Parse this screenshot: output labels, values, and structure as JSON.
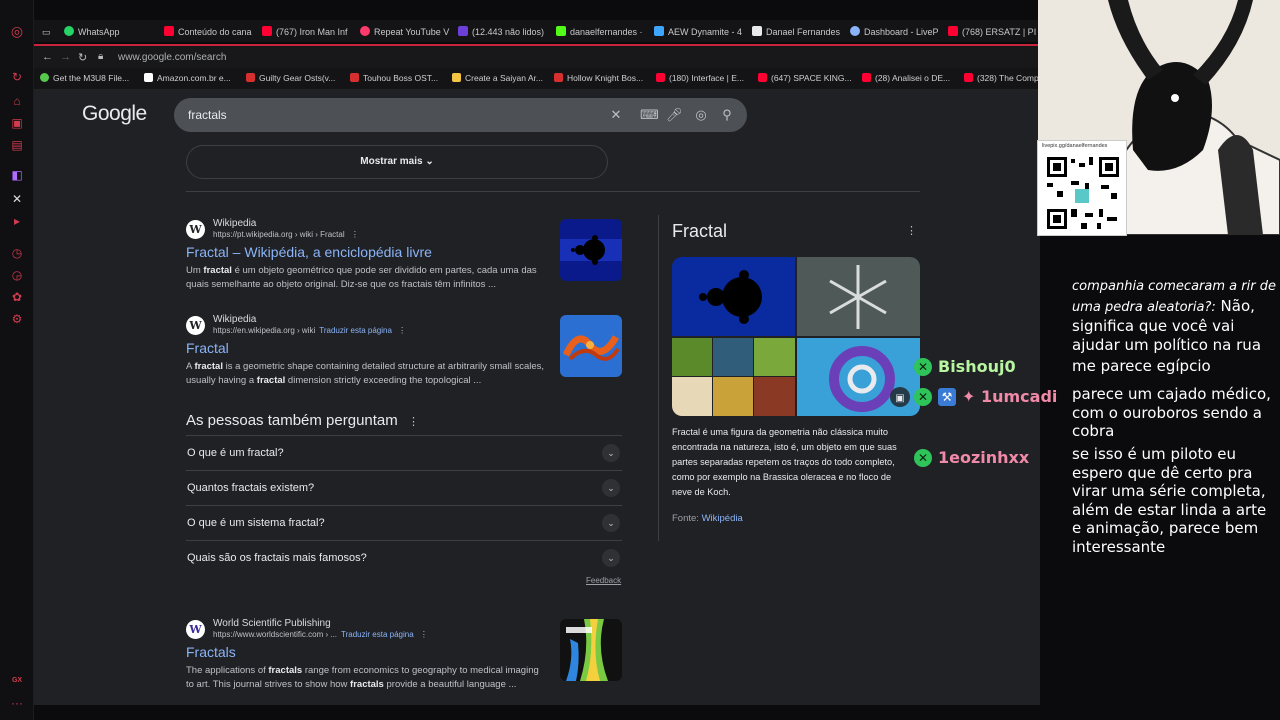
{
  "browser": {
    "tabs": [
      {
        "label": "WhatsApp",
        "color": "#25d366"
      },
      {
        "label": "Conteúdo do cana",
        "color": "#ff0033"
      },
      {
        "label": "(767) Iron Man Inf",
        "color": "#ff0033"
      },
      {
        "label": "Repeat YouTube V",
        "color": "#ff3b6b"
      },
      {
        "label": "(12.443 não lidos)",
        "color": "#6b3fd8"
      },
      {
        "label": "danaelfernandes ·",
        "color": "#53fc18"
      },
      {
        "label": "AEW Dynamite - 4",
        "color": "#3ea6ff"
      },
      {
        "label": "Danael Fernandes",
        "color": "#e8eaed"
      },
      {
        "label": "Dashboard - LiveP",
        "color": "#8ab4f8"
      },
      {
        "label": "(768) ERSATZ | PI",
        "color": "#ff0033"
      }
    ],
    "url": "www.google.com/search",
    "bookmarks": [
      {
        "label": "Get the M3U8 File...",
        "color": "#57c84d"
      },
      {
        "label": "Amazon.com.br e...",
        "color": "#ffffff"
      },
      {
        "label": "Guilty Gear Osts(v...",
        "color": "#d62f2f"
      },
      {
        "label": "Touhou Boss OST...",
        "color": "#d62f2f"
      },
      {
        "label": "Create a Saiyan Ar...",
        "color": "#f4c542"
      },
      {
        "label": "Hollow Knight Bos...",
        "color": "#d62f2f"
      },
      {
        "label": "(180) Interface | E...",
        "color": "#ff0033"
      },
      {
        "label": "(647) SPACE KING...",
        "color": "#ff0033"
      },
      {
        "label": "(28) Analisei o DE...",
        "color": "#ff0033"
      },
      {
        "label": "(328) The Comp",
        "color": "#ff0033"
      }
    ]
  },
  "google": {
    "logo": "Google",
    "query": "fractals",
    "show_more": "Mostrar mais",
    "results": [
      {
        "site": "Wikipedia",
        "url": "https://pt.wikipedia.org › wiki › Fractal",
        "translate": "",
        "title": "Fractal – Wikipédia, a enciclopédia livre",
        "snippet_html": "Um <b>fractal</b> é um objeto geométrico que pode ser dividido em partes, cada uma das quais semelhante ao objeto original. Diz-se que os fractais têm infinitos ...",
        "favicon": "W"
      },
      {
        "site": "Wikipedia",
        "url": "https://en.wikipedia.org › wiki",
        "translate": "Traduzir esta página",
        "title": "Fractal",
        "snippet_html": "A <b>fractal</b> is a geometric shape containing detailed structure at arbitrarily small scales, usually having a <b>fractal</b> dimension strictly exceeding the topological ...",
        "favicon": "W"
      },
      {
        "site": "World Scientific Publishing",
        "url": "https://www.worldscientific.com › ...",
        "translate": "Traduzir esta página",
        "title": "Fractals",
        "snippet_html": "The applications of <b>fractals</b> range from economics to geography to medical imaging to art. This journal strives to show how <b>fractals</b> provide a beautiful language ...",
        "favicon": "W"
      }
    ],
    "paa_title": "As pessoas também perguntam",
    "paa": [
      "O que é um fractal?",
      "Quantos fractais existem?",
      "O que é um sistema fractal?",
      "Quais são os fractais mais famosos?"
    ],
    "feedback": "Feedback",
    "kp": {
      "title": "Fractal",
      "description": "Fractal é uma figura da geometria não clássica muito encontrada na natureza, isto é, um objeto em que suas partes separadas repetem os traços do todo completo, como por exemplo na Brassica oleracea e no floco de neve de Koch.",
      "source_label": "Fonte:",
      "source_link": "Wikipédia"
    }
  },
  "overlay": {
    "qr_label": "livepix.gg/danaelfernandes",
    "chat": [
      {
        "user": "Bishouj0",
        "color": "#b8f5a0",
        "msg_top": "companhia comecaram a rir de uma pedra aleatoria?:",
        "msg": "Não, significa que você vai ajudar um político na rua"
      },
      {
        "user": "✦ 1umcadi",
        "color": "#f08aa8",
        "msg": "parece um cajado médico, com o ouroboros sendo a cobra"
      },
      {
        "user": "1eozinhxx",
        "color": "#f08aa8",
        "msg": "se isso é um piloto eu espero que dê certo pra virar uma série completa, além de estar linda a arte e animação, parece bem interessante"
      }
    ],
    "extra_msg": "me parece egípcio"
  }
}
